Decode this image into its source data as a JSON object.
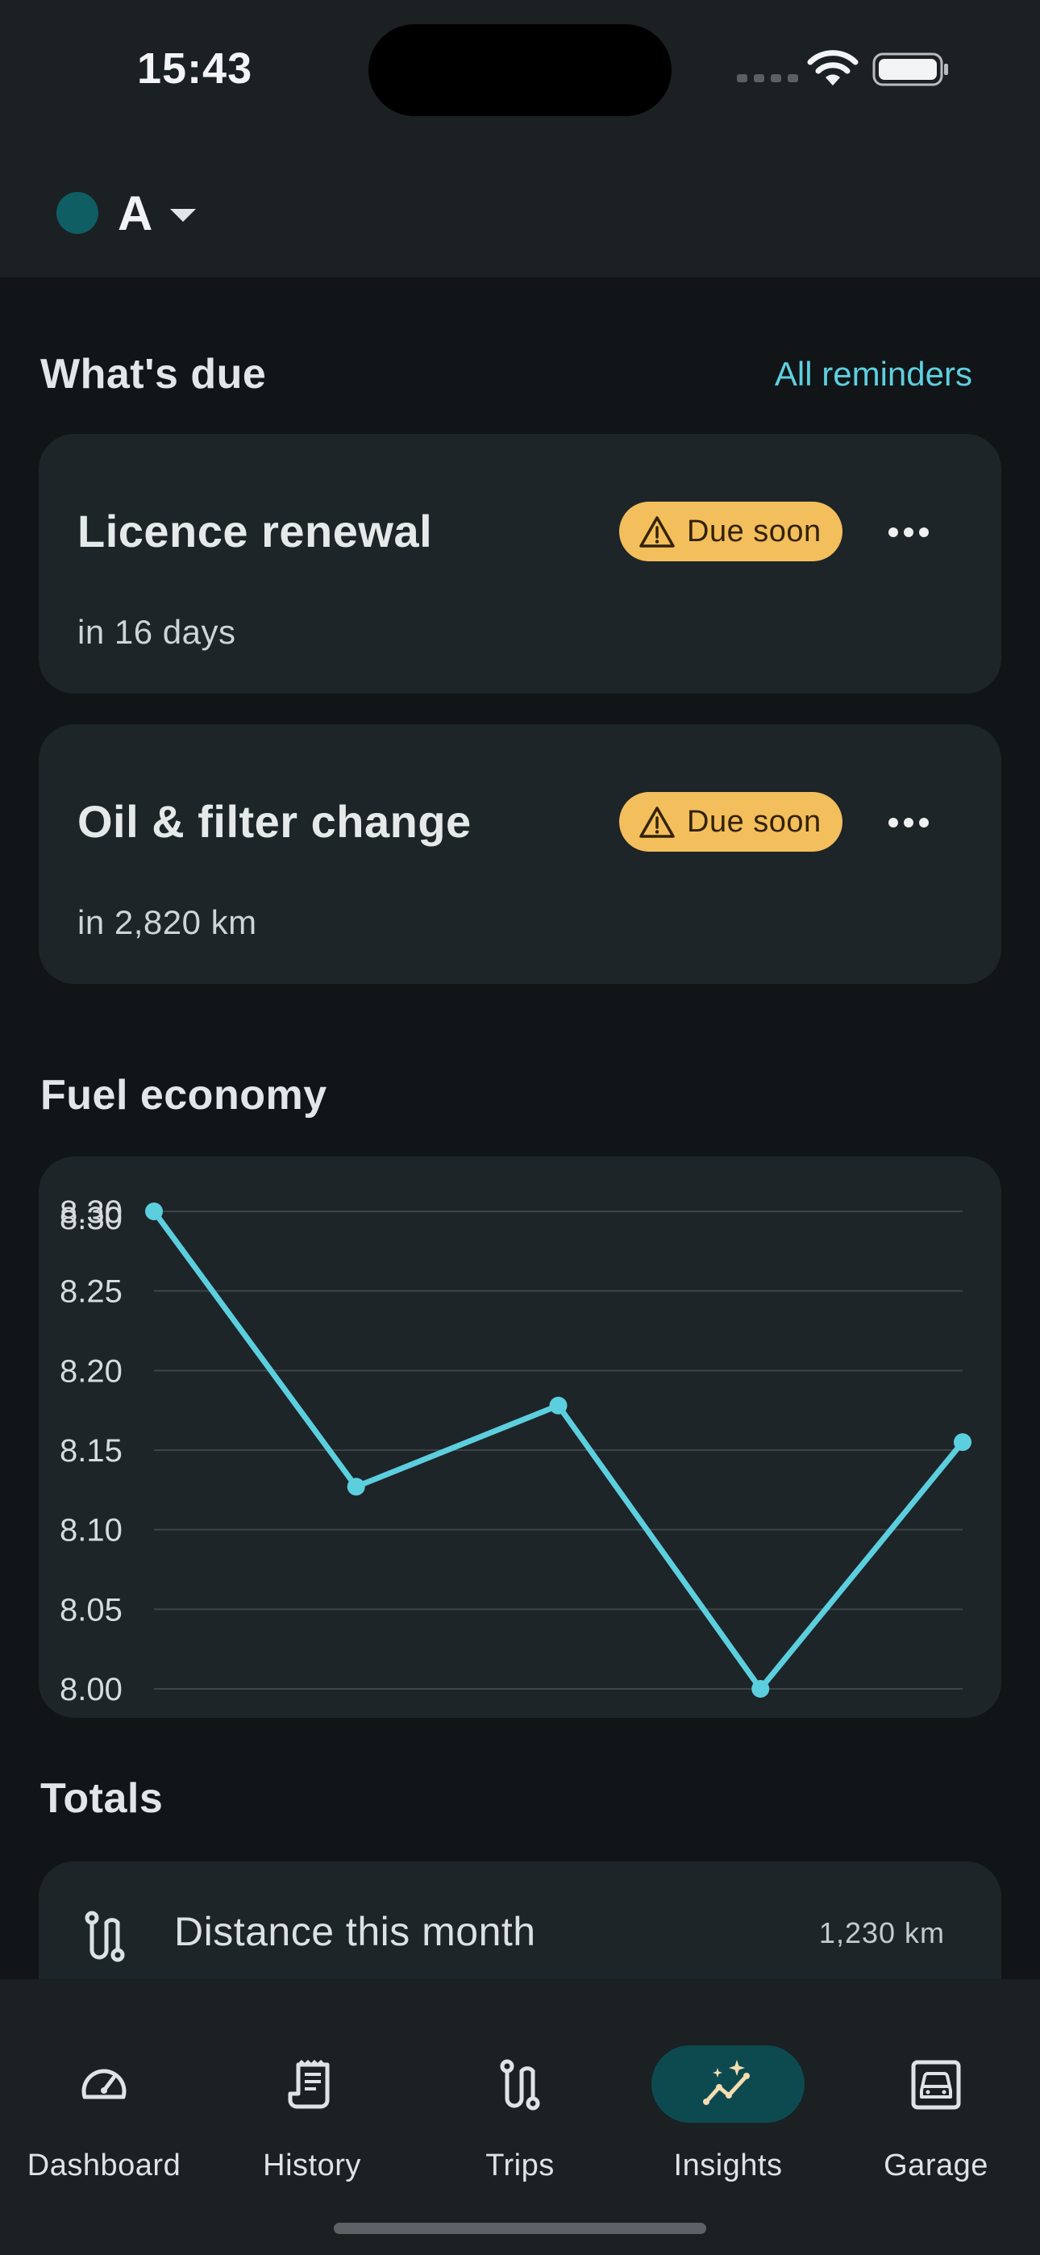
{
  "status_bar": {
    "time": "15:43"
  },
  "header": {
    "vehicle_name": "A",
    "vehicle_color": "#0e5e64"
  },
  "whats_due": {
    "title": "What's due",
    "link_label": "All reminders",
    "reminders": [
      {
        "title": "Licence renewal",
        "subtitle": "in 16 days",
        "badge": "Due soon"
      },
      {
        "title": "Oil & filter change",
        "subtitle": "in 2,820 km",
        "badge": "Due soon"
      }
    ]
  },
  "fuel_economy": {
    "title": "Fuel economy"
  },
  "chart_data": {
    "type": "line",
    "title": "",
    "xlabel": "",
    "ylabel": "",
    "x": [
      1,
      2,
      3,
      4,
      5
    ],
    "series": [
      {
        "values": [
          8.3,
          8.127,
          8.178,
          8.0,
          8.155
        ]
      }
    ],
    "ylim": [
      8.0,
      8.3
    ],
    "yticks": [
      "8.00",
      "8.05",
      "8.10",
      "8.15",
      "8.20",
      "8.25",
      "8.30",
      "8.30"
    ],
    "grid": true,
    "line_color": "#5ccfdf",
    "grid_color": "#3e4549"
  },
  "totals": {
    "title": "Totals",
    "items": [
      {
        "label": "Distance this month",
        "value": "1,230 km",
        "icon": "route-icon"
      }
    ]
  },
  "bottom_nav": {
    "items": [
      {
        "label": "Dashboard",
        "icon": "speedometer-icon",
        "active": false
      },
      {
        "label": "History",
        "icon": "receipt-icon",
        "active": false
      },
      {
        "label": "Trips",
        "icon": "route-icon",
        "active": false
      },
      {
        "label": "Insights",
        "icon": "sparkle-chart-icon",
        "active": true
      },
      {
        "label": "Garage",
        "icon": "car-icon",
        "active": false
      }
    ],
    "active_color": "#0c4a50"
  },
  "colors": {
    "accent": "#5ecfe0",
    "badge_warning": "#f3be5c",
    "card": "#1d2528",
    "background": "#111517"
  }
}
